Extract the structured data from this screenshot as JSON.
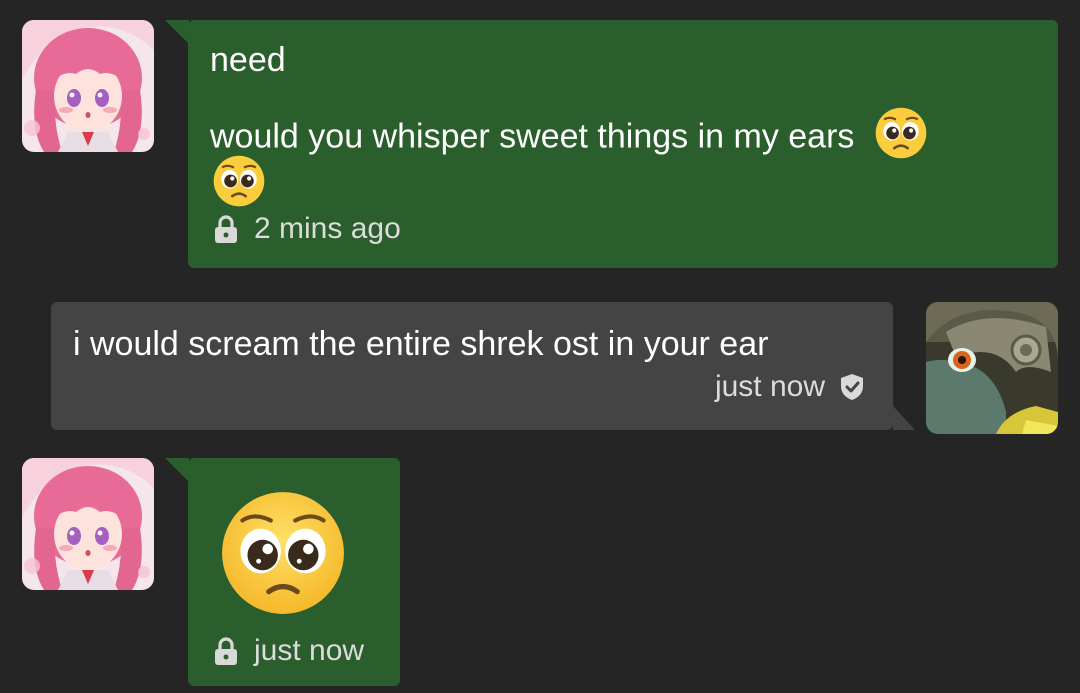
{
  "colors": {
    "background": "#252525",
    "outgoing_bubble": "#2a5e2c",
    "incoming_bubble": "#444444",
    "meta_text": "#d9d9d9"
  },
  "messages": [
    {
      "sender": "self",
      "avatar_icon": "anime-girl-avatar",
      "lines": [
        "need",
        "would you whisper sweet things in my ears"
      ],
      "emoji": "pleading-face-emoji",
      "status_icon": "lock-icon",
      "timestamp": "2 mins ago"
    },
    {
      "sender": "other",
      "avatar_icon": "midna-avatar",
      "text": "i would scream the entire shrek ost in your ear",
      "status_icon": "verified-shield-icon",
      "timestamp": "just now"
    },
    {
      "sender": "self",
      "avatar_icon": "anime-girl-avatar",
      "emoji": "pleading-face-emoji",
      "status_icon": "lock-icon",
      "timestamp": "just now"
    }
  ]
}
